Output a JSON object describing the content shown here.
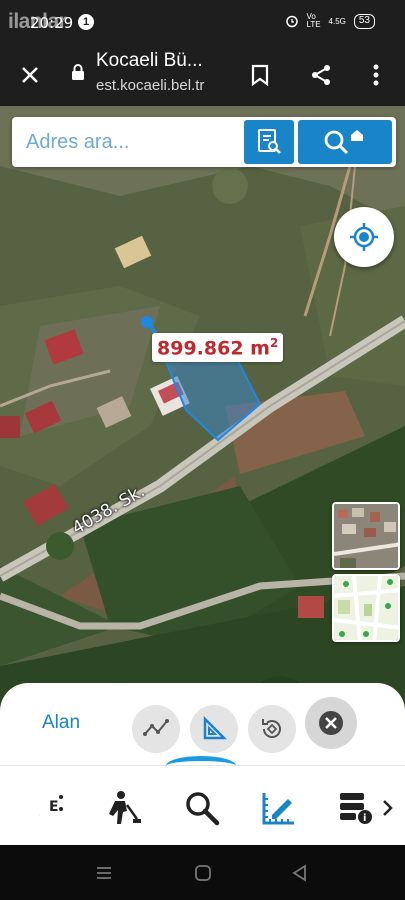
{
  "status_bar": {
    "time": "20:29",
    "watermark": "ilanlar",
    "notification_count": "1",
    "network": "Vo LTE",
    "signal": "4.5G",
    "battery": "53"
  },
  "browser": {
    "title": "Kocaeli Bü...",
    "url": "est.kocaeli.bel.tr"
  },
  "search": {
    "placeholder": "Adres ara..."
  },
  "map": {
    "area_value": "899.862 m",
    "area_unit_exp": "2",
    "street_name": "4038. Sk.",
    "parcel_color": "#1e88e5",
    "label_color": "#c0282e"
  },
  "measure_panel": {
    "mode_label": "Alan",
    "tools": [
      "distance-tool-icon",
      "area-tool-icon",
      "reset-rotate-icon",
      "close-icon"
    ]
  },
  "toolbar": {
    "items": [
      "e-municipality-icon",
      "road-works-icon",
      "search-icon",
      "measure-icon",
      "layers-info-icon"
    ],
    "active": "measure-icon",
    "accent": "#1a9be0"
  }
}
